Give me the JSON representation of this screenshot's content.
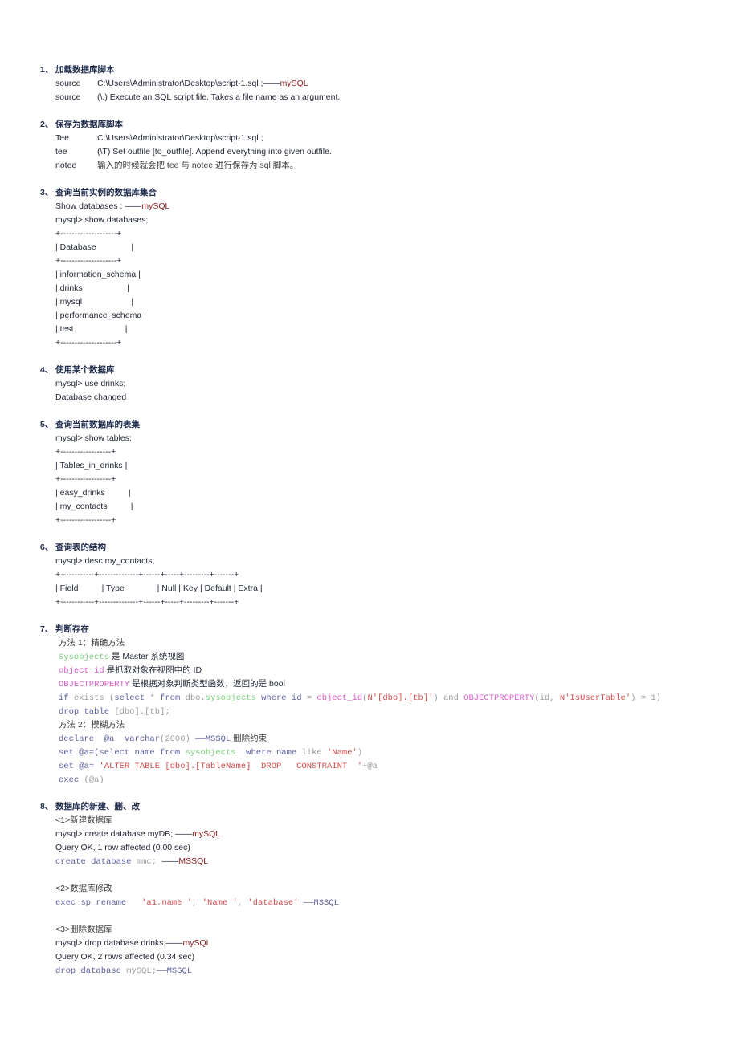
{
  "colors": {
    "text": "#1e2433",
    "heading": "#1d2a4a",
    "mysql": "#8b1c1c",
    "kw": "#5b5f9e",
    "green": "#7ccf7c",
    "pink": "#d65ac8",
    "str": "#d24b4b",
    "gray": "#9a9a9a",
    "cn": "#3a3a3a"
  },
  "sections": [
    {
      "num": "1、",
      "title": "加载数据库脚本",
      "lines": [
        {
          "label": "source",
          "segs": [
            {
              "t": "C:\\Users\\Administrator\\Desktop\\script-1.sql ;——"
            },
            {
              "t": "mySQL",
              "c": "mysql"
            }
          ]
        },
        {
          "label": "source",
          "segs": [
            {
              "t": "(\\.) Execute an SQL script file. Takes a file name as an argument."
            }
          ]
        }
      ]
    },
    {
      "num": "2、",
      "title": "保存为数据库脚本",
      "lines": [
        {
          "label": "Tee",
          "segs": [
            {
              "t": "C:\\Users\\Administrator\\Desktop\\script-1.sql ;"
            }
          ]
        },
        {
          "label": "tee",
          "segs": [
            {
              "t": "(\\T) Set outfile [to_outfile]. Append everything into given outfile."
            }
          ]
        },
        {
          "label": "notee",
          "segs": [
            {
              "t": "输入的时候就会把 tee 与 notee 进行保存为 sql 脚本。",
              "c": "cn"
            }
          ]
        }
      ]
    },
    {
      "num": "3、",
      "title": "查询当前实例的数据库集合",
      "lines": [
        {
          "segs": [
            {
              "t": "Show databases ; ——"
            },
            {
              "t": "mySQL",
              "c": "mysql"
            }
          ]
        },
        {
          "segs": [
            {
              "t": "mysql> show databases;"
            }
          ]
        },
        {
          "segs": [
            {
              "t": "+--------------------+"
            }
          ]
        },
        {
          "segs": [
            {
              "t": "| Database               |"
            }
          ]
        },
        {
          "segs": [
            {
              "t": "+--------------------+"
            }
          ]
        },
        {
          "segs": [
            {
              "t": "| information_schema |"
            }
          ]
        },
        {
          "segs": [
            {
              "t": "| drinks                   |"
            }
          ]
        },
        {
          "segs": [
            {
              "t": "| mysql                     |"
            }
          ]
        },
        {
          "segs": [
            {
              "t": "| performance_schema |"
            }
          ]
        },
        {
          "segs": [
            {
              "t": "| test                      |"
            }
          ]
        },
        {
          "segs": [
            {
              "t": "+--------------------+"
            }
          ]
        }
      ]
    },
    {
      "num": "4、",
      "title": "使用某个数据库",
      "lines": [
        {
          "segs": [
            {
              "t": "mysql> use drinks;"
            }
          ]
        },
        {
          "segs": [
            {
              "t": "Database changed"
            }
          ]
        }
      ]
    },
    {
      "num": "5、",
      "title": "查询当前数据库的表集",
      "lines": [
        {
          "segs": [
            {
              "t": "mysql> show tables;"
            }
          ]
        },
        {
          "segs": [
            {
              "t": "+------------------+"
            }
          ]
        },
        {
          "segs": [
            {
              "t": "| Tables_in_drinks |"
            }
          ]
        },
        {
          "segs": [
            {
              "t": "+------------------+"
            }
          ]
        },
        {
          "segs": [
            {
              "t": "| easy_drinks          |"
            }
          ]
        },
        {
          "segs": [
            {
              "t": "| my_contacts          |"
            }
          ]
        },
        {
          "segs": [
            {
              "t": "+------------------+"
            }
          ]
        }
      ]
    },
    {
      "num": "6、",
      "title": "查询表的结构",
      "lines": [
        {
          "segs": [
            {
              "t": "mysql> desc my_contacts;"
            }
          ]
        },
        {
          "segs": [
            {
              "t": "+------------+--------------+------+-----+---------+-------+"
            }
          ]
        },
        {
          "segs": [
            {
              "t": "| Field          | Type              | Null | Key | Default | Extra |"
            }
          ]
        },
        {
          "segs": [
            {
              "t": "+------------+--------------+------+-----+---------+-------+"
            }
          ]
        }
      ]
    },
    {
      "num": "7、",
      "title": "判断存在",
      "indent2": true,
      "lines": [
        {
          "segs": [
            {
              "t": "方法 1：精确方法",
              "c": "cn"
            }
          ]
        },
        {
          "segs": [
            {
              "t": "Sysobjects",
              "c": "green",
              "m": 1
            },
            {
              "t": " 是 Master 系统视图"
            }
          ]
        },
        {
          "segs": [
            {
              "t": "object_id",
              "c": "pink",
              "m": 1
            },
            {
              "t": " 是抓取对象在视图中的 ID"
            }
          ]
        },
        {
          "segs": [
            {
              "t": "OBJECTPROPERTY",
              "c": "pink",
              "m": 1
            },
            {
              "t": " 是根据对象判断类型函数，返回的是 bool"
            }
          ]
        },
        {
          "segs": [
            {
              "t": "if ",
              "c": "kw",
              "m": 1
            },
            {
              "t": "exists (",
              "c": "gray",
              "m": 1
            },
            {
              "t": "select ",
              "c": "kw",
              "m": 1
            },
            {
              "t": "* ",
              "c": "gray",
              "m": 1
            },
            {
              "t": "from ",
              "c": "kw",
              "m": 1
            },
            {
              "t": "dbo.",
              "c": "gray",
              "m": 1
            },
            {
              "t": "sysobjects",
              "c": "green",
              "m": 1
            },
            {
              "t": " where id ",
              "c": "kw",
              "m": 1
            },
            {
              "t": "= ",
              "c": "gray",
              "m": 1
            },
            {
              "t": "object_id",
              "c": "pink",
              "m": 1
            },
            {
              "t": "(",
              "c": "gray",
              "m": 1
            },
            {
              "t": "N'[dbo].[tb]'",
              "c": "str",
              "m": 1
            },
            {
              "t": ") and ",
              "c": "gray",
              "m": 1
            },
            {
              "t": "OBJECTPROPERTY",
              "c": "pink",
              "m": 1
            },
            {
              "t": "(id, ",
              "c": "gray",
              "m": 1
            },
            {
              "t": "N'IsUserTable'",
              "c": "str",
              "m": 1
            },
            {
              "t": ") = 1)",
              "c": "gray",
              "m": 1
            }
          ]
        },
        {
          "segs": [
            {
              "t": "drop table ",
              "c": "kw",
              "m": 1
            },
            {
              "t": "[dbo].[tb];",
              "c": "gray",
              "m": 1
            }
          ]
        },
        {
          "segs": [
            {
              "t": "方法 2：模糊方法",
              "c": "cn"
            }
          ]
        },
        {
          "segs": [
            {
              "t": "declare  @a  varchar",
              "c": "kw",
              "m": 1
            },
            {
              "t": "(2000) ",
              "c": "gray",
              "m": 1
            },
            {
              "t": "——MSSQL",
              "c": "kw",
              "m": 1
            },
            {
              "t": " 删除约束",
              "c": "cn"
            }
          ]
        },
        {
          "segs": [
            {
              "t": "set @a=(",
              "c": "kw",
              "m": 1
            },
            {
              "t": "select name from ",
              "c": "kw",
              "m": 1
            },
            {
              "t": "sysobjects",
              "c": "green",
              "m": 1
            },
            {
              "t": "  where name ",
              "c": "kw",
              "m": 1
            },
            {
              "t": "like ",
              "c": "gray",
              "m": 1
            },
            {
              "t": "'Name'",
              "c": "str",
              "m": 1
            },
            {
              "t": ")",
              "c": "gray",
              "m": 1
            }
          ]
        },
        {
          "segs": [
            {
              "t": "set @a= ",
              "c": "kw",
              "m": 1
            },
            {
              "t": "'ALTER TABLE [dbo].[TableName]  DROP   CONSTRAINT  '",
              "c": "str",
              "m": 1
            },
            {
              "t": "+@a",
              "c": "gray",
              "m": 1
            }
          ]
        },
        {
          "segs": [
            {
              "t": "exec ",
              "c": "kw",
              "m": 1
            },
            {
              "t": "(@a)",
              "c": "gray",
              "m": 1
            }
          ]
        }
      ]
    },
    {
      "num": "8、",
      "title": "数据库的新建、删、改",
      "lines": [
        {
          "segs": [
            {
              "t": "<1>新建数据库",
              "c": "cn"
            }
          ]
        },
        {
          "segs": [
            {
              "t": "mysql> create database myDB; ——"
            },
            {
              "t": "mySQL",
              "c": "mysql"
            }
          ]
        },
        {
          "segs": [
            {
              "t": "Query OK, 1 row affected (0.00 sec)"
            }
          ]
        },
        {
          "segs": [
            {
              "t": "create database ",
              "c": "kw",
              "m": 1
            },
            {
              "t": "mmc; ",
              "c": "gray",
              "m": 1
            },
            {
              "t": "——"
            },
            {
              "t": "MSSQL",
              "c": "mysql"
            }
          ]
        },
        {
          "blank": true
        },
        {
          "segs": [
            {
              "t": "<2>数据库修改",
              "c": "cn"
            }
          ]
        },
        {
          "segs": [
            {
              "t": "exec sp_rename   ",
              "c": "kw",
              "m": 1
            },
            {
              "t": "'a1.name '",
              "c": "str",
              "m": 1
            },
            {
              "t": ", ",
              "c": "gray",
              "m": 1
            },
            {
              "t": "'Name '",
              "c": "str",
              "m": 1
            },
            {
              "t": ", ",
              "c": "gray",
              "m": 1
            },
            {
              "t": "'database'",
              "c": "str",
              "m": 1
            },
            {
              "t": " ——MSSQL",
              "c": "kw",
              "m": 1
            }
          ]
        },
        {
          "blank": true
        },
        {
          "segs": [
            {
              "t": "<3>删除数据库",
              "c": "cn"
            }
          ]
        },
        {
          "segs": [
            {
              "t": "mysql> drop database drinks;——"
            },
            {
              "t": "mySQL",
              "c": "mysql"
            }
          ]
        },
        {
          "segs": [
            {
              "t": "Query OK, 2 rows affected (0.34 sec)"
            }
          ]
        },
        {
          "segs": [
            {
              "t": "drop database ",
              "c": "kw",
              "m": 1
            },
            {
              "t": "mySQL;",
              "c": "gray",
              "m": 1
            },
            {
              "t": "——MSSQL",
              "c": "kw",
              "m": 1
            }
          ]
        }
      ]
    }
  ]
}
